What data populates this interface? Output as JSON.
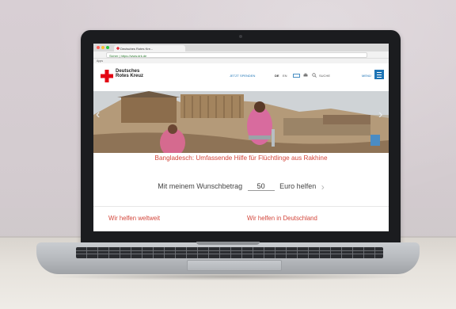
{
  "browser": {
    "tab_title": "Deutsches Rotes Kre...",
    "address": "Sicher | https://www.drk.de",
    "bookmarks": "Apps"
  },
  "site": {
    "logo_text": "Deutsches Rotes Kreuz",
    "nav": {
      "donate": "JETZT SPENDEN",
      "lang_de": "DE",
      "lang_en": "EN",
      "search": "SUCHE",
      "menu": "MENÜ"
    },
    "headline": "Bangladesch: Umfassende Hilfe für Flüchtlinge aus Rakhine",
    "donation": {
      "prefix": "Mit meinem Wunschbetrag",
      "amount": "50",
      "suffix": "Euro helfen"
    },
    "links": {
      "worldwide": "Wir helfen weltweit",
      "germany": "Wir helfen in Deutschland"
    }
  },
  "colors": {
    "brand_red": "#e30613",
    "accent_blue": "#1d74b5",
    "link_red": "#d3463b"
  },
  "icons": [
    "red-cross-icon",
    "accessibility-icon",
    "print-icon",
    "search-icon",
    "menu-icon",
    "chevron-left-icon",
    "chevron-right-icon"
  ]
}
